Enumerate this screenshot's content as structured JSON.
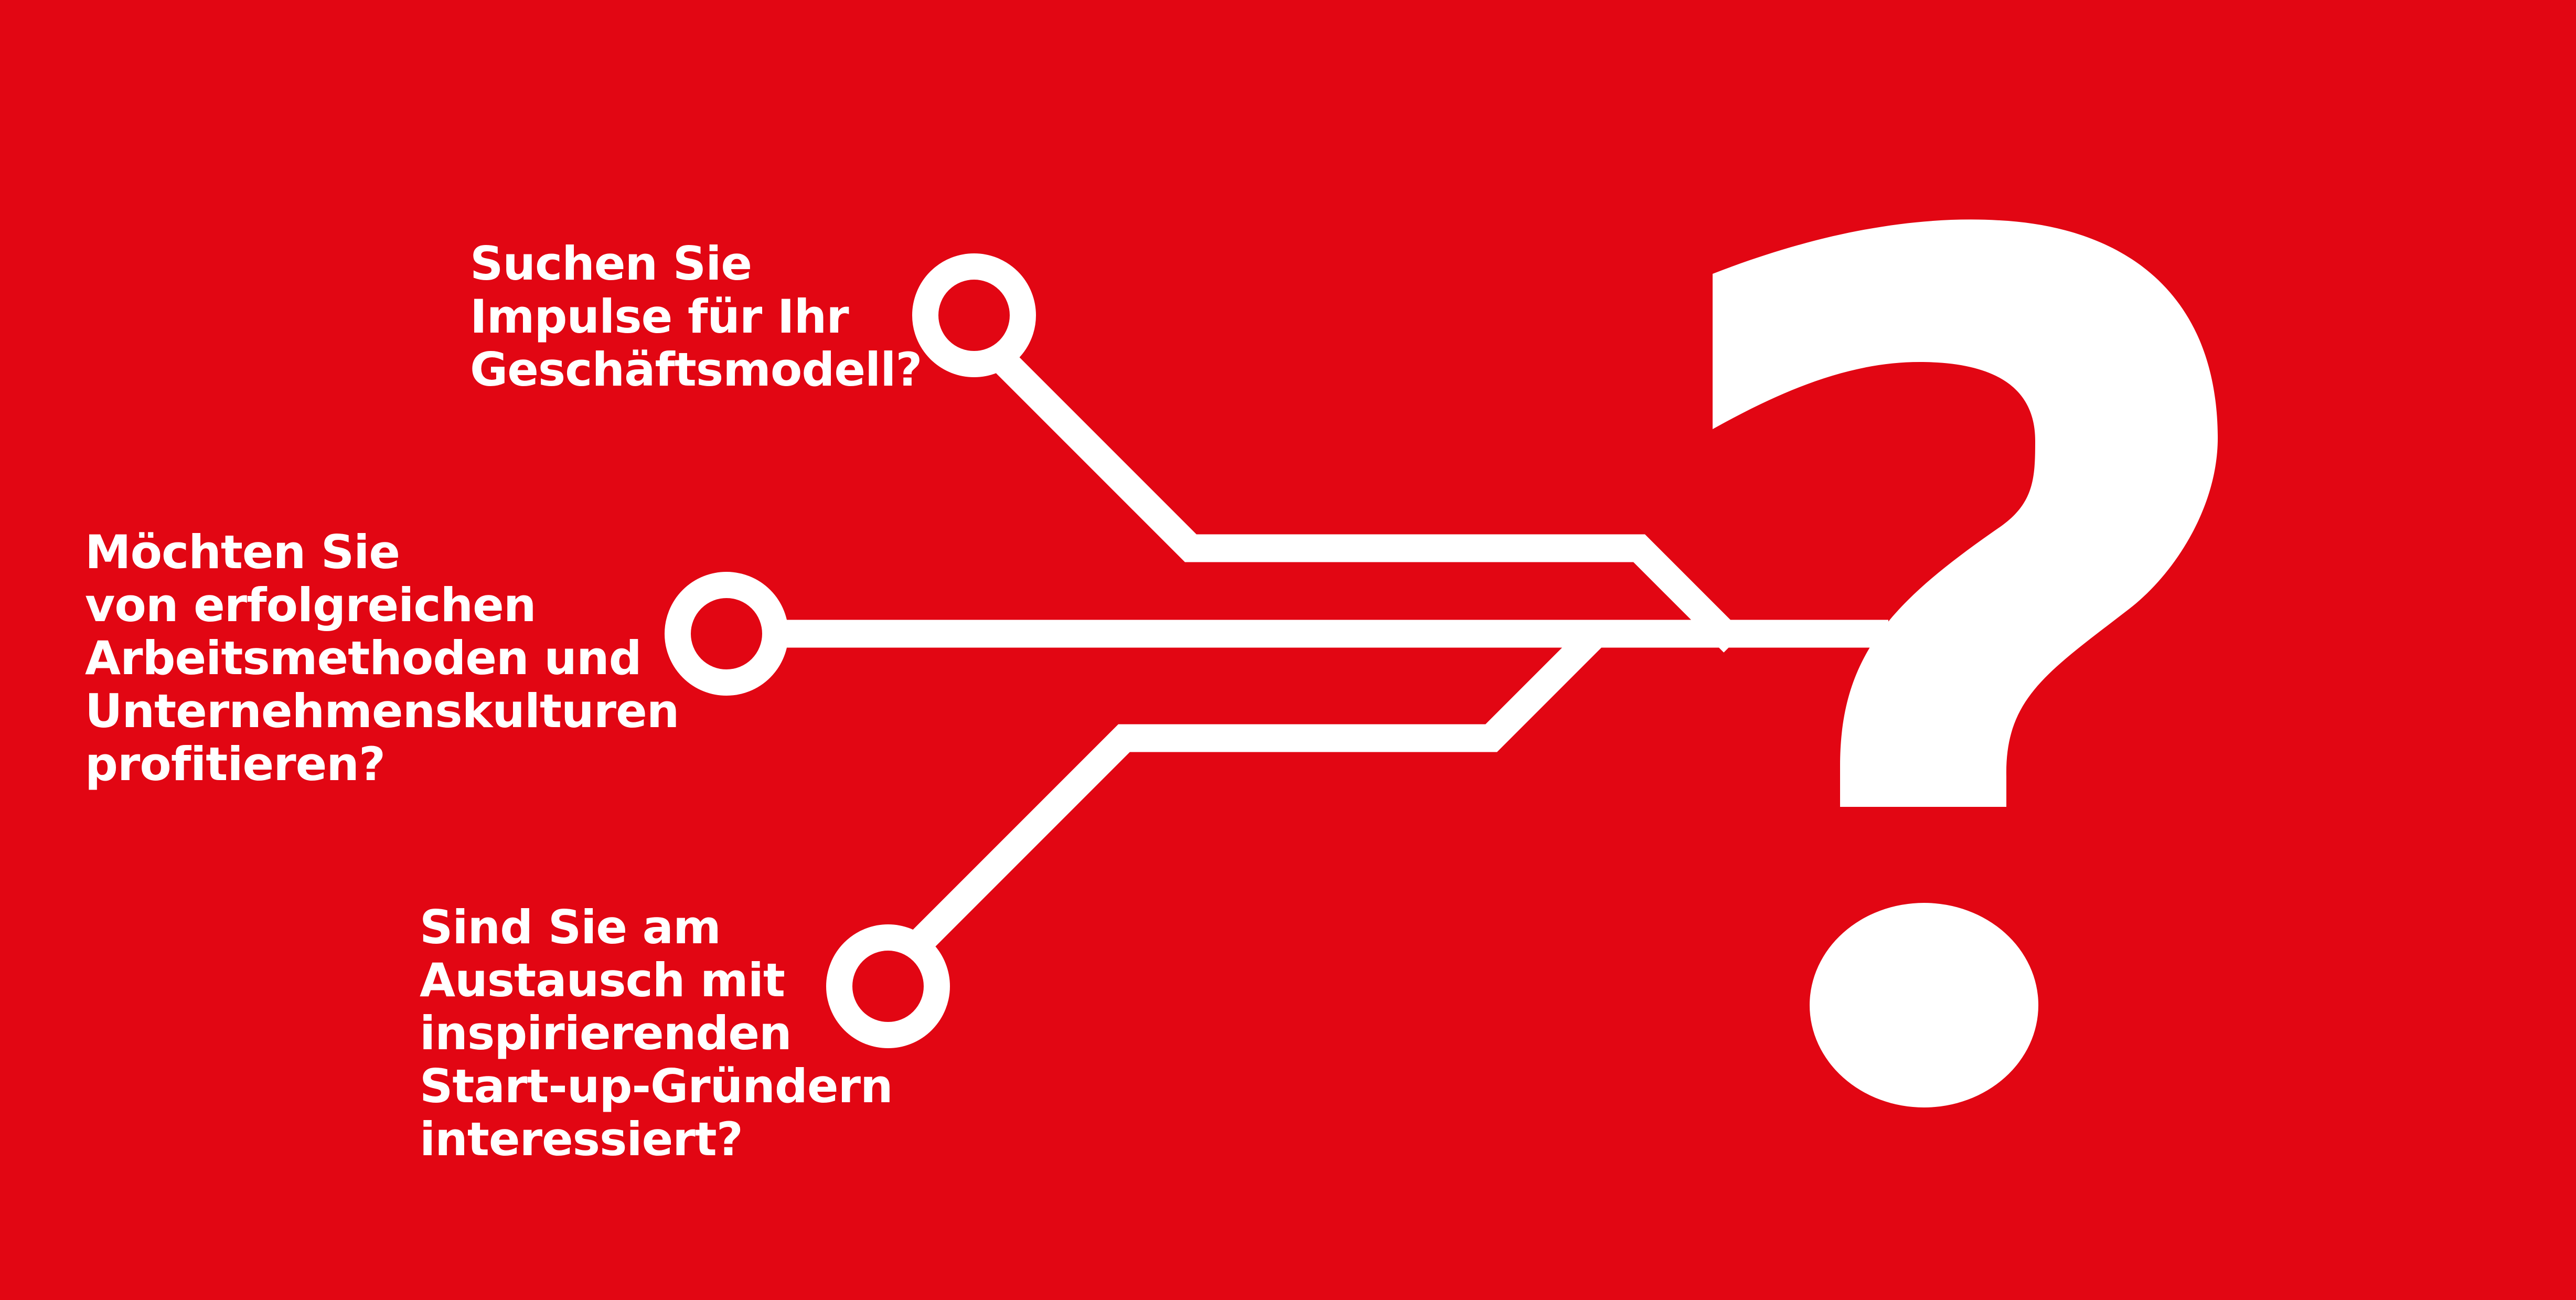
{
  "colors": {
    "background": "#e20613",
    "foreground": "#ffffff"
  },
  "icons": {
    "circuit": "circuit-lines-icon",
    "question_mark": "question-mark-icon"
  },
  "questions": [
    {
      "lines": [
        "Suchen Sie",
        "Impulse für Ihr",
        "Geschäftsmodell?"
      ]
    },
    {
      "lines": [
        "Möchten Sie",
        "von erfolgreichen",
        "Arbeitsmethoden und",
        "Unternehmenskulturen",
        "profitieren?"
      ]
    },
    {
      "lines": [
        "Sind Sie am",
        "Austausch mit",
        "inspirierenden",
        "Start-up-Gründern",
        "interessiert?"
      ]
    }
  ]
}
